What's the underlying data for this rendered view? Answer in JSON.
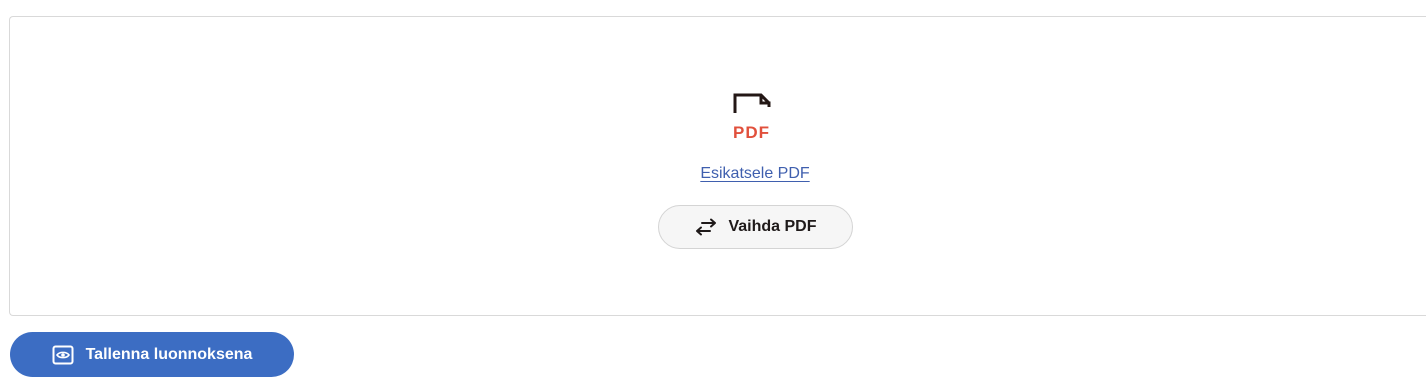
{
  "upload": {
    "icon": "pdf-file-icon",
    "icon_text": "PDF",
    "preview_link": "Esikatsele PDF",
    "replace_button": {
      "label": "Vaihda PDF",
      "icon": "swap-arrows-icon"
    }
  },
  "actions": {
    "save_draft": {
      "label": "Tallenna luonnoksena",
      "icon": "eye-icon"
    }
  },
  "colors": {
    "pdf_red": "#e1503c",
    "link_blue": "#3f5fae",
    "primary_button": "#3c6dc3",
    "dark_text": "#1f1a1a"
  }
}
